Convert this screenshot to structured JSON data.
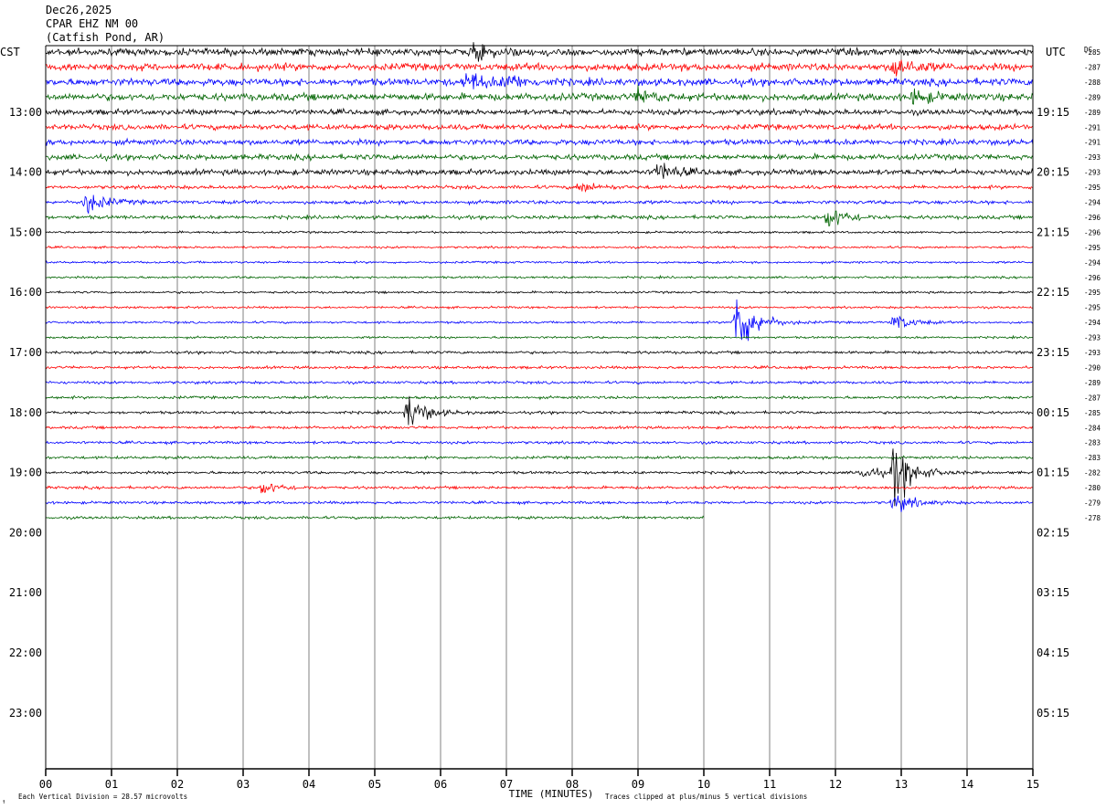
{
  "header": {
    "date": "Dec26,2025",
    "station": "CPAR EHZ NM 00",
    "location": "(Catfish Pond, AR)"
  },
  "left_zone_label": "CST",
  "right_zone_label": "UTC",
  "dc_label": "DC",
  "footer": {
    "scale_note": "Each Vertical Division =   28.57 microvolts",
    "clip_note": "Traces clipped at plus/minus 5 vertical divisions",
    "corner_mark": "↑"
  },
  "colors": {
    "trace_cycle": [
      "#000000",
      "#ff0000",
      "#0000ff",
      "#006400"
    ],
    "grid": "#808080"
  },
  "chart_data": {
    "type": "line",
    "xlabel": "TIME (MINUTES)",
    "x_ticks": [
      "00",
      "01",
      "02",
      "03",
      "04",
      "05",
      "06",
      "07",
      "08",
      "09",
      "10",
      "11",
      "12",
      "13",
      "14",
      "15"
    ],
    "xlim": [
      0,
      15
    ],
    "left_hour_labels": [
      "13:00",
      "14:00",
      "15:00",
      "16:00",
      "17:00",
      "18:00",
      "19:00",
      "20:00",
      "21:00",
      "22:00",
      "23:00"
    ],
    "right_hour_labels": [
      "19:15",
      "20:15",
      "21:15",
      "22:15",
      "23:15",
      "00:15",
      "01:15",
      "02:15",
      "03:15",
      "04:15",
      "05:15"
    ],
    "dc_offsets": [
      -285,
      -287,
      -288,
      -289,
      -289,
      -291,
      -291,
      -293,
      -293,
      -295,
      -294,
      -296,
      -296,
      -295,
      -294,
      -296,
      -295,
      -295,
      -294,
      -293,
      -293,
      -290,
      -289,
      -287,
      -285,
      -284,
      -283,
      -283,
      -282,
      -280,
      -279,
      -278
    ],
    "traces_recorded": 32,
    "last_trace_end_minute": 10.0,
    "events": [
      {
        "trace": 0,
        "minute": 6.5,
        "amp": 1.0
      },
      {
        "trace": 1,
        "minute": 12.9,
        "amp": 1.5
      },
      {
        "trace": 2,
        "minute": 6.4,
        "amp": 1.3
      },
      {
        "trace": 2,
        "minute": 7.0,
        "amp": 0.9
      },
      {
        "trace": 3,
        "minute": 9.0,
        "amp": 0.9
      },
      {
        "trace": 3,
        "minute": 13.2,
        "amp": 0.9
      },
      {
        "trace": 8,
        "minute": 9.3,
        "amp": 1.3
      },
      {
        "trace": 9,
        "minute": 8.1,
        "amp": 0.7
      },
      {
        "trace": 10,
        "minute": 0.6,
        "amp": 1.5
      },
      {
        "trace": 11,
        "minute": 11.9,
        "amp": 1.6
      },
      {
        "trace": 18,
        "minute": 10.5,
        "amp": 4.5
      },
      {
        "trace": 18,
        "minute": 12.9,
        "amp": 1.1
      },
      {
        "trace": 24,
        "minute": 5.5,
        "amp": 2.2
      },
      {
        "trace": 28,
        "minute": 12.9,
        "amp": 3.6
      },
      {
        "trace": 28,
        "minute": 12.4,
        "amp": 1.0
      },
      {
        "trace": 29,
        "minute": 3.3,
        "amp": 0.9
      },
      {
        "trace": 30,
        "minute": 12.9,
        "amp": 1.3
      }
    ]
  }
}
